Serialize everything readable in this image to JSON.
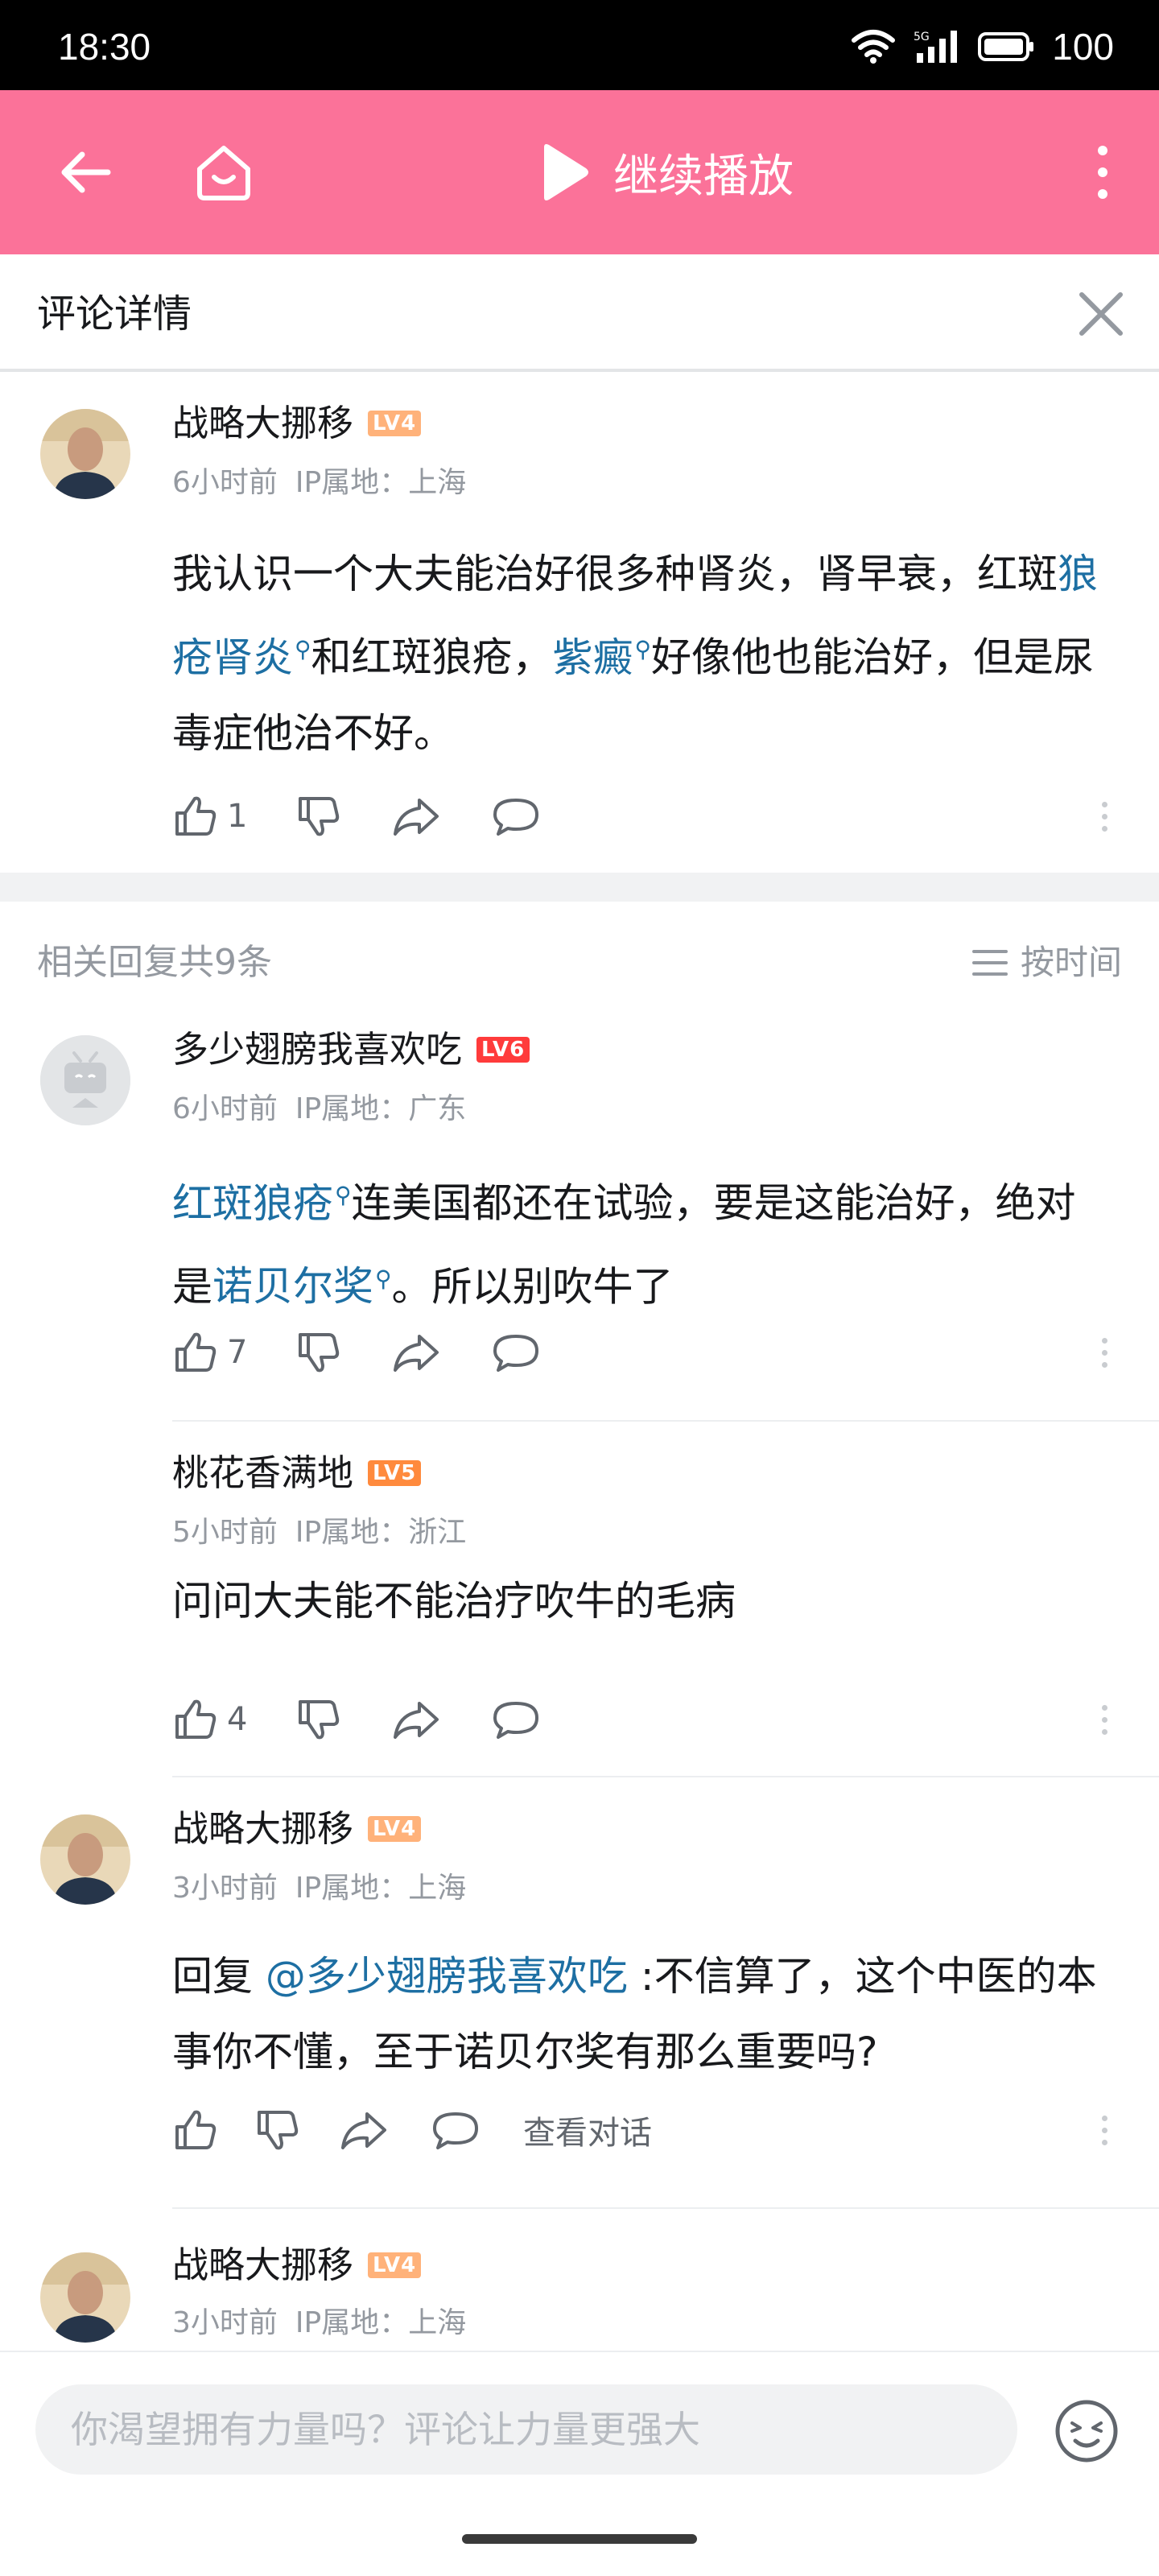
{
  "status_bar": {
    "time": "18:30",
    "battery": "100"
  },
  "top_bar": {
    "continue_label": "继续播放"
  },
  "detail_header": {
    "title": "评论详情"
  },
  "main_comment": {
    "username": "战略大挪移",
    "level": "LV4",
    "time": "6小时前",
    "ip": "IP属地：上海",
    "text_parts": [
      "我认识一个大夫能治好很多种肾炎，肾早衰，红斑",
      "狼疮肾炎",
      "和红斑狼疮，",
      "紫癜",
      "好像他也能治好，但是尿毒症他治不好。"
    ],
    "likes": "1"
  },
  "replies_header": {
    "count_label": "相关回复共9条",
    "sort_label": "按时间"
  },
  "replies": [
    {
      "username": "多少翅膀我喜欢吃",
      "level": "LV6",
      "time": "6小时前",
      "ip": "IP属地：广东",
      "text_parts": [
        "红斑狼疮",
        "连美国都还在试验，要是这能治好，绝对是",
        "诺贝尔奖",
        "。所以别吹牛了"
      ],
      "likes": "7"
    },
    {
      "username": "桃花香满地",
      "level": "LV5",
      "time": "5小时前",
      "ip": "IP属地：浙江",
      "text": "问问大夫能不能治疗吹牛的毛病",
      "likes": "4"
    },
    {
      "username": "战略大挪移",
      "level": "LV4",
      "time": "3小时前",
      "ip": "IP属地：上海",
      "reply_prefix": "回复 ",
      "mention": "@多少翅膀我喜欢吃",
      "text": " :不信算了，这个中医的本事你不懂，至于诺贝尔奖有那么重要吗?",
      "view_dialog": "查看对话"
    },
    {
      "username": "战略大挪移",
      "level": "LV4",
      "time": "3小时前",
      "ip": "IP属地：上海"
    }
  ],
  "composer": {
    "placeholder": "你渴望拥有力量吗？评论让力量更强大"
  },
  "colors": {
    "brand_pink": "#fb7299",
    "link_blue": "#1d6fa3",
    "meta_gray": "#9499a0"
  },
  "icons": [
    "wifi-icon",
    "signal-icon",
    "battery-icon",
    "back-arrow-icon",
    "home-icon",
    "play-icon",
    "more-vertical-icon",
    "close-icon",
    "thumb-up-icon",
    "thumb-down-icon",
    "share-icon",
    "reply-bubble-icon",
    "sort-lines-icon",
    "emoji-icon",
    "search-mini-icon"
  ]
}
